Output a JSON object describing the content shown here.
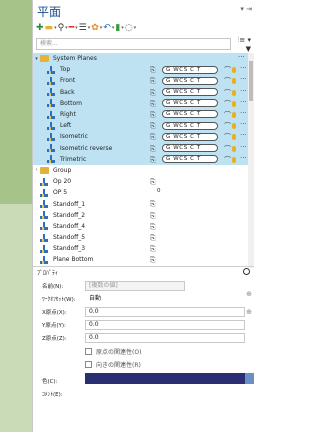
{
  "title": "平面",
  "window_controls": "▾ ⇥",
  "toolbar": {
    "items": [
      {
        "icon": "add-plus-icon",
        "glyph": "✚",
        "color": "#2e8b3a"
      },
      {
        "icon": "folder-add-icon",
        "glyph": "▬",
        "color": "#e3b23c"
      },
      {
        "icon": "search-zoom-icon",
        "glyph": "⚲",
        "color": "#333333"
      },
      {
        "icon": "delete-icon",
        "glyph": "━",
        "color": "#d42a2a"
      },
      {
        "icon": "list-icon",
        "glyph": "☰",
        "color": "#333333"
      },
      {
        "icon": "settings-icon",
        "glyph": "✿",
        "color": "#e88a1a"
      },
      {
        "icon": "undo-icon",
        "glyph": "↶",
        "color": "#2c6fbf"
      },
      {
        "icon": "color-icon",
        "glyph": "▮",
        "color": "#3a9a3a"
      },
      {
        "icon": "view-icon",
        "glyph": "◌",
        "color": "#555555"
      }
    ]
  },
  "search": {
    "placeholder": "検索..."
  },
  "search_tools": "⫶≡ ▾ ▼",
  "tree": {
    "header": {
      "label": "System Planes",
      "more": "···"
    },
    "system_planes": [
      {
        "label": "Top",
        "wcs": "G  WCS  C  T"
      },
      {
        "label": "Front",
        "wcs": "G  WCS  C  T"
      },
      {
        "label": "Back",
        "wcs": "G  WCS  C  T"
      },
      {
        "label": "Bottom",
        "wcs": "G  WCS  C  T"
      },
      {
        "label": "Right",
        "wcs": "G  WCS  C  T"
      },
      {
        "label": "Left",
        "wcs": "G  WCS  C  T"
      },
      {
        "label": "Isometric",
        "wcs": "G  WCS  C  T"
      },
      {
        "label": "Isometric reverse",
        "wcs": "G  WCS  C  T"
      },
      {
        "label": "Trimetric",
        "wcs": "G  WCS  C  T"
      }
    ],
    "group": {
      "label": "Group"
    },
    "others": [
      {
        "label": "Op 20",
        "num": ""
      },
      {
        "label": "OP 5",
        "num": "0"
      },
      {
        "label": "Standoff_1",
        "num": ""
      },
      {
        "label": "Standoff_2",
        "num": ""
      },
      {
        "label": "Standoff_4",
        "num": ""
      },
      {
        "label": "Standoff_5",
        "num": ""
      },
      {
        "label": "Standoff_3",
        "num": ""
      },
      {
        "label": "Plane Bottom",
        "num": ""
      }
    ]
  },
  "properties": {
    "header": "ﾌﾟﾛﾊﾟﾃｨ",
    "name_label": "名前(N):",
    "name_placeholder": "[複数の値]",
    "workoffset_label": "ﾜｰｸｵﾌｾｯﾄ(W):",
    "workoffset_value": "自動",
    "x_label": "X原点(X):",
    "x_value": "0.0",
    "y_label": "Y原点(Y):",
    "y_value": "0.0",
    "z_label": "Z原点(Z):",
    "z_value": "0.0",
    "chk1": "原点の関連性(O)",
    "chk2": "向きの関連性(R)",
    "color_label": "色(C):",
    "comment_label": "ｺﾒﾝﾄ(E):"
  }
}
